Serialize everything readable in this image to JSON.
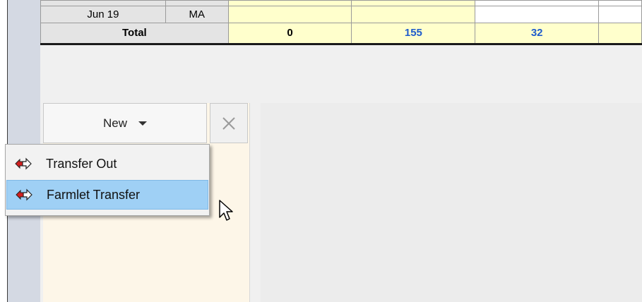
{
  "grid": {
    "rows": [
      {
        "date": "Jun 19",
        "code": "MA",
        "values": [
          "",
          "",
          "",
          ""
        ]
      }
    ],
    "total": {
      "label": "Total",
      "values": [
        "0",
        "155",
        "32",
        ""
      ]
    }
  },
  "toolbar": {
    "new_label": "New",
    "delete_icon": "close-x-icon"
  },
  "dropdown": {
    "items": [
      {
        "label": "Transfer Out",
        "icon": "transfer-arrow-icon"
      },
      {
        "label": "Farmlet Transfer",
        "icon": "transfer-arrow-icon",
        "highlighted": true
      }
    ]
  },
  "colors": {
    "total_value": "#1f5ccc",
    "cell_yellow": "#ffffcc",
    "menu_highlight": "#9fd0f5"
  }
}
